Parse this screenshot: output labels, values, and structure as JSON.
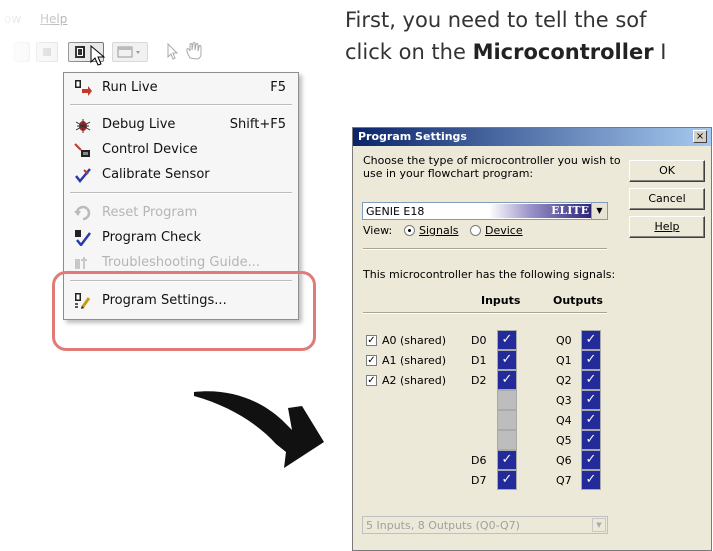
{
  "instruction": {
    "line1": "First, you need to tell the sof",
    "line2_prefix": "click on the ",
    "line2_bold": "Microcontroller",
    "line2_suffix": " I"
  },
  "left_screenshot": {
    "menubar": [
      "ow",
      "Help"
    ],
    "menu": {
      "items": [
        {
          "label": "Run Live",
          "shortcut": "F5",
          "icon": "run-live-icon",
          "enabled": true
        },
        {
          "label": "Debug Live",
          "shortcut": "Shift+F5",
          "icon": "bug-icon",
          "enabled": true
        },
        {
          "label": "Control Device",
          "shortcut": "",
          "icon": "control-device-icon",
          "enabled": true
        },
        {
          "label": "Calibrate Sensor",
          "shortcut": "",
          "icon": "calibrate-icon",
          "enabled": true
        },
        {
          "label": "Reset Program",
          "shortcut": "",
          "icon": "reset-icon",
          "enabled": false
        },
        {
          "label": "Program Check",
          "shortcut": "",
          "icon": "program-check-icon",
          "enabled": true
        },
        {
          "label": "Troubleshooting Guide...",
          "shortcut": "",
          "icon": "troubleshoot-icon",
          "enabled": false
        },
        {
          "label": "Program Settings...",
          "shortcut": "",
          "icon": "program-settings-icon",
          "enabled": true
        }
      ]
    },
    "highlight_color": "#e07b78"
  },
  "dialog": {
    "title": "Program Settings",
    "close": "×",
    "prompt_line1": "Choose the type of microcontroller you wish to",
    "prompt_line2": "use in your flowchart program:",
    "selected_controller": "GENIE E18",
    "badge": "ELITE",
    "buttons": {
      "ok": "OK",
      "cancel": "Cancel",
      "help": "Help"
    },
    "view_label": "View:",
    "view_options": [
      "Signals",
      "Device"
    ],
    "view_selected": "Signals",
    "signals_caption": "This microcontroller has the following signals:",
    "inputs_header": "Inputs",
    "outputs_header": "Outputs",
    "analog_options": [
      {
        "label": "A0 (shared)",
        "checked": true
      },
      {
        "label": "A1 (shared)",
        "checked": true
      },
      {
        "label": "A2 (shared)",
        "checked": true
      }
    ],
    "inputs": [
      {
        "label": "D0",
        "active": true
      },
      {
        "label": "D1",
        "active": true
      },
      {
        "label": "D2",
        "active": true
      },
      {
        "label": "",
        "active": false
      },
      {
        "label": "",
        "active": false
      },
      {
        "label": "",
        "active": false
      },
      {
        "label": "D6",
        "active": true
      },
      {
        "label": "D7",
        "active": true
      }
    ],
    "outputs": [
      {
        "label": "Q0",
        "active": true
      },
      {
        "label": "Q1",
        "active": true
      },
      {
        "label": "Q2",
        "active": true
      },
      {
        "label": "Q3",
        "active": true
      },
      {
        "label": "Q4",
        "active": true
      },
      {
        "label": "Q5",
        "active": true
      },
      {
        "label": "Q6",
        "active": true
      },
      {
        "label": "Q7",
        "active": true
      }
    ],
    "check_mark": "✓",
    "summary": "5 Inputs, 8 Outputs (Q0-Q7)",
    "accent_color": "#232a9a"
  }
}
